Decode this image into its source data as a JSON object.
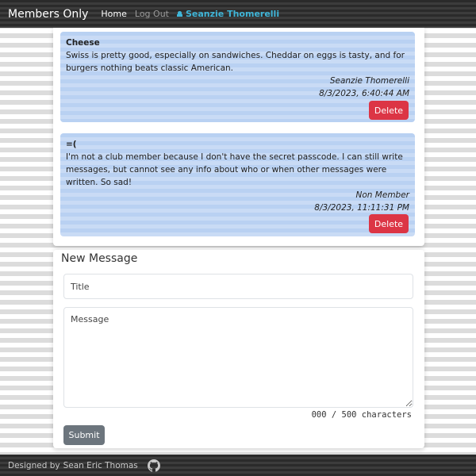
{
  "nav": {
    "brand": "Members Only",
    "home": "Home",
    "logout": "Log Out",
    "user": "Seanzie Thomerelli"
  },
  "messages": [
    {
      "title": "Cheese",
      "body": "Swiss is pretty good, especially on sandwiches. Cheddar on eggs is tasty, and for burgers nothing beats classic American.",
      "author": "Seanzie Thomerelli",
      "date": "8/3/2023, 6:40:44 AM",
      "delete_label": "Delete"
    },
    {
      "title": "=(",
      "body": "I'm not a club member because I don't have the secret passcode. I can still write messages, but cannot see any info about who or when other messages were written. So sad!",
      "author": "Non Member",
      "date": "8/3/2023, 11:11:31 PM",
      "delete_label": "Delete"
    }
  ],
  "new_message": {
    "heading": "New Message",
    "title_placeholder": "Title",
    "message_placeholder": "Message",
    "char_count": "000 / 500 characters",
    "submit_label": "Submit"
  },
  "footer": {
    "designed_by": "Designed by",
    "author": "Sean Eric Thomas"
  },
  "colors": {
    "delete": "#dc3545",
    "submit": "#6c757d",
    "user_link": "#3fb5d8",
    "message_bg": "#b9d1f2"
  }
}
